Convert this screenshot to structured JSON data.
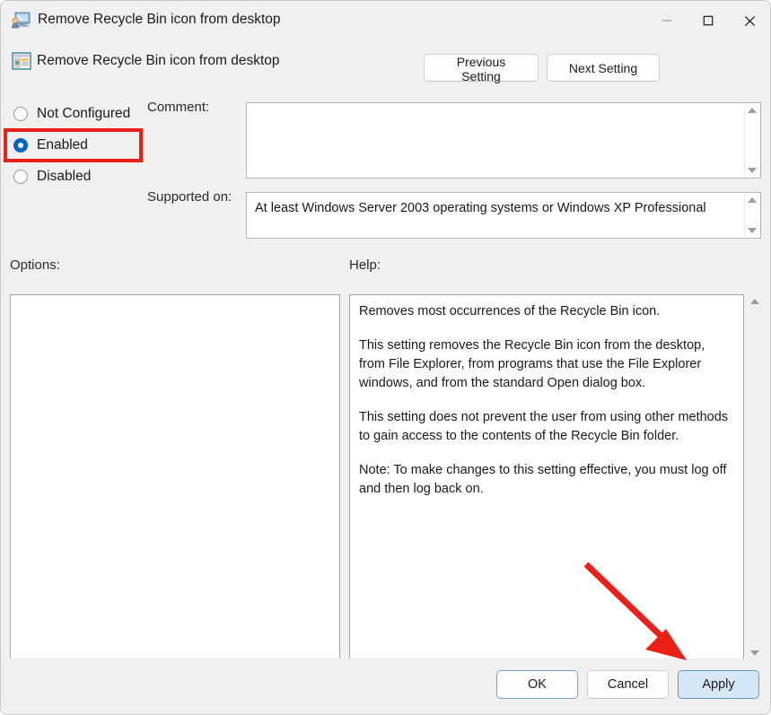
{
  "window": {
    "title": "Remove Recycle Bin icon from desktop",
    "icon": "policy-setting-icon",
    "caption": {
      "minimize": "minimize-icon",
      "maximize": "maximize-icon",
      "close": "close-icon"
    }
  },
  "setting_header": {
    "icon": "group-policy-dialog-icon",
    "title": "Remove Recycle Bin icon from desktop",
    "previous_button": "Previous Setting",
    "next_button": "Next Setting"
  },
  "state_options": [
    {
      "label": "Not Configured",
      "selected": false
    },
    {
      "label": "Enabled",
      "selected": true
    },
    {
      "label": "Disabled",
      "selected": false
    }
  ],
  "comment": {
    "label": "Comment:",
    "value": ""
  },
  "supported_on": {
    "label": "Supported on:",
    "value": "At least Windows Server 2003 operating systems or Windows XP Professional"
  },
  "options": {
    "label": "Options:",
    "value": ""
  },
  "help": {
    "label": "Help:",
    "paragraphs": [
      "Removes most occurrences of the Recycle Bin icon.",
      "This setting removes the Recycle Bin icon from the desktop, from File Explorer, from programs that use the File Explorer windows, and from the standard Open dialog box.",
      "This setting does not prevent the user from using other methods to gain access to the contents of the Recycle Bin folder.",
      "Note: To make changes to this setting effective, you must log off and then log back on."
    ]
  },
  "footer": {
    "ok": "OK",
    "cancel": "Cancel",
    "apply": "Apply"
  },
  "annotations": {
    "highlight_color": "#ed2017",
    "arrow_color": "#ed2017",
    "highlight_target": "Enabled",
    "arrow_target": "Apply"
  }
}
